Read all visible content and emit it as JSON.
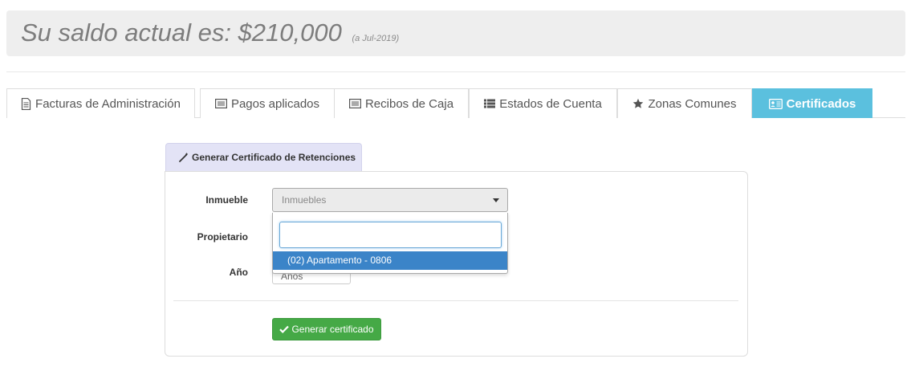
{
  "balance": {
    "text": "Su saldo actual es: $210,000",
    "date": "(a Jul-2019)"
  },
  "tabs": [
    {
      "label": "Facturas de Administración",
      "icon": "document-icon",
      "active": false
    },
    {
      "label": "Pagos aplicados",
      "icon": "list-box-icon",
      "active": false
    },
    {
      "label": "Recibos de Caja",
      "icon": "list-box-icon",
      "active": false
    },
    {
      "label": "Estados de Cuenta",
      "icon": "list-icon",
      "active": false
    },
    {
      "label": "Zonas Comunes",
      "icon": "star-icon",
      "active": false
    },
    {
      "label": "Certificados",
      "icon": "id-card-icon",
      "active": true
    }
  ],
  "form": {
    "panel_title": "Generar Certificado de Retenciones",
    "inmueble_label": "Inmueble",
    "inmueble_value": "Inmuebles",
    "propietario_label": "Propietario",
    "anio_label": "Año",
    "anio_value": "Años",
    "dropdown_search_value": "",
    "dropdown_options": [
      "(02) Apartamento - 0806"
    ],
    "generate_button": "Generar certificado"
  },
  "colors": {
    "active_tab": "#5bc0de",
    "generate_button": "#45a946",
    "highlight_option": "#3b84c8",
    "panel_tab_bg": "#e3e3f6"
  }
}
